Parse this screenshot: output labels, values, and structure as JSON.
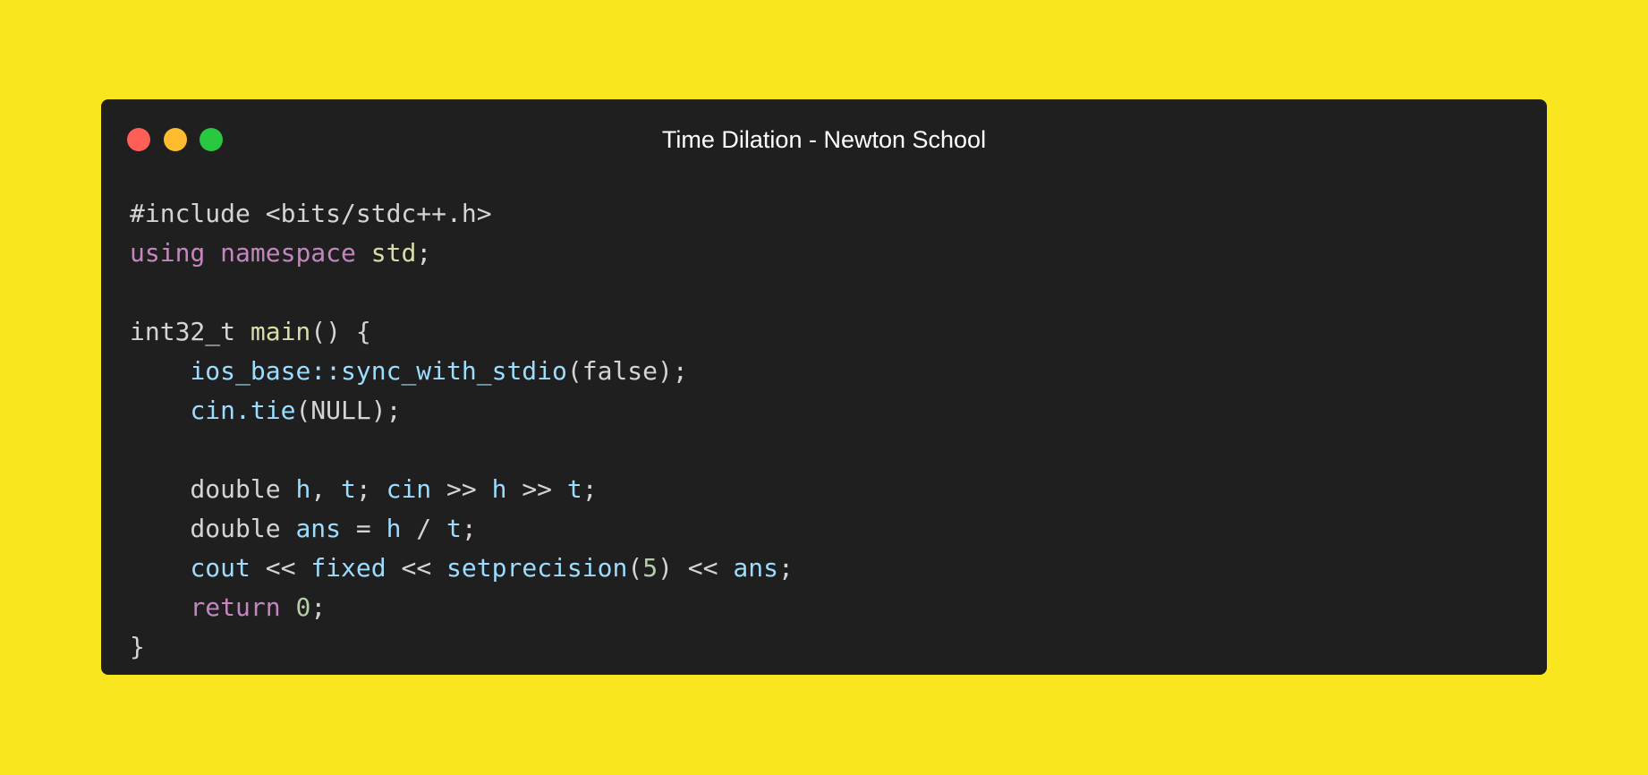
{
  "window": {
    "title": "Time Dilation - Newton School",
    "buttons": [
      {
        "name": "close",
        "color": "#ff5f57"
      },
      {
        "name": "minimize",
        "color": "#febc2e"
      },
      {
        "name": "maximize",
        "color": "#28c840"
      }
    ]
  },
  "colors": {
    "background": "#f9e61f",
    "editor_background": "#1f1f1f",
    "default_text": "#d4d4d4",
    "keyword": "#c586c0",
    "function": "#dcdcaa",
    "identifier": "#9cdcfe",
    "number": "#b5cea8"
  },
  "code": {
    "lines": [
      [
        {
          "t": "#include <bits/stdc++.h>",
          "c": "default"
        }
      ],
      [
        {
          "t": "using",
          "c": "keyword"
        },
        {
          "t": " ",
          "c": "default"
        },
        {
          "t": "namespace",
          "c": "keyword"
        },
        {
          "t": " ",
          "c": "default"
        },
        {
          "t": "std",
          "c": "function"
        },
        {
          "t": ";",
          "c": "default"
        }
      ],
      [],
      [
        {
          "t": "int32_t ",
          "c": "default"
        },
        {
          "t": "main",
          "c": "function"
        },
        {
          "t": "() {",
          "c": "default"
        }
      ],
      [
        {
          "t": "    ",
          "c": "default"
        },
        {
          "t": "ios_base::sync_with_stdio",
          "c": "identifier"
        },
        {
          "t": "(false);",
          "c": "default"
        }
      ],
      [
        {
          "t": "    ",
          "c": "default"
        },
        {
          "t": "cin.tie",
          "c": "identifier"
        },
        {
          "t": "(NULL);",
          "c": "default"
        }
      ],
      [],
      [
        {
          "t": "    double ",
          "c": "default"
        },
        {
          "t": "h",
          "c": "identifier"
        },
        {
          "t": ", ",
          "c": "default"
        },
        {
          "t": "t",
          "c": "identifier"
        },
        {
          "t": "; ",
          "c": "default"
        },
        {
          "t": "cin",
          "c": "identifier"
        },
        {
          "t": " >> ",
          "c": "default"
        },
        {
          "t": "h",
          "c": "identifier"
        },
        {
          "t": " >> ",
          "c": "default"
        },
        {
          "t": "t",
          "c": "identifier"
        },
        {
          "t": ";",
          "c": "default"
        }
      ],
      [
        {
          "t": "    double ",
          "c": "default"
        },
        {
          "t": "ans",
          "c": "identifier"
        },
        {
          "t": " = ",
          "c": "default"
        },
        {
          "t": "h",
          "c": "identifier"
        },
        {
          "t": " / ",
          "c": "default"
        },
        {
          "t": "t",
          "c": "identifier"
        },
        {
          "t": ";",
          "c": "default"
        }
      ],
      [
        {
          "t": "    ",
          "c": "default"
        },
        {
          "t": "cout",
          "c": "identifier"
        },
        {
          "t": " << ",
          "c": "default"
        },
        {
          "t": "fixed",
          "c": "identifier"
        },
        {
          "t": " << ",
          "c": "default"
        },
        {
          "t": "setprecision",
          "c": "identifier"
        },
        {
          "t": "(",
          "c": "default"
        },
        {
          "t": "5",
          "c": "number"
        },
        {
          "t": ") << ",
          "c": "default"
        },
        {
          "t": "ans",
          "c": "identifier"
        },
        {
          "t": ";",
          "c": "default"
        }
      ],
      [
        {
          "t": "    ",
          "c": "default"
        },
        {
          "t": "return",
          "c": "keyword"
        },
        {
          "t": " ",
          "c": "default"
        },
        {
          "t": "0",
          "c": "number"
        },
        {
          "t": ";",
          "c": "default"
        }
      ],
      [
        {
          "t": "}",
          "c": "default"
        }
      ]
    ]
  }
}
